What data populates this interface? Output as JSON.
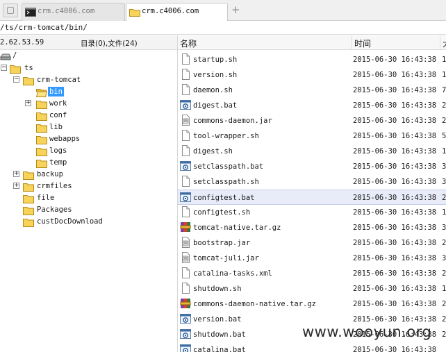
{
  "tabs": [
    {
      "label": "crm.c4006.com",
      "icon": "terminal-icon",
      "active": false
    },
    {
      "label": "crm.c4006.com",
      "icon": "folder-icon",
      "active": true
    }
  ],
  "path": "/ts/crm-tomcat/bin/",
  "left_panel": {
    "host": "2.62.53.59",
    "summary": "目录(0),文件(24)"
  },
  "tree": [
    {
      "label": "/",
      "icon": "drive-icon",
      "expander": ""
    },
    {
      "label": "ts",
      "icon": "folder-icon",
      "expander": "−"
    },
    {
      "label": "crm-tomcat",
      "icon": "folder-icon",
      "expander": "−"
    },
    {
      "label": "bin",
      "icon": "folder-open-icon",
      "expander": "",
      "selected": true
    },
    {
      "label": "work",
      "icon": "folder-icon",
      "expander": "+"
    },
    {
      "label": "conf",
      "icon": "folder-icon",
      "expander": ""
    },
    {
      "label": "lib",
      "icon": "folder-icon",
      "expander": ""
    },
    {
      "label": "webapps",
      "icon": "folder-icon",
      "expander": ""
    },
    {
      "label": "logs",
      "icon": "folder-icon",
      "expander": ""
    },
    {
      "label": "temp",
      "icon": "folder-icon",
      "expander": ""
    },
    {
      "label": "backup",
      "icon": "folder-icon",
      "expander": "+"
    },
    {
      "label": "crmfiles",
      "icon": "folder-icon",
      "expander": "+"
    },
    {
      "label": "file",
      "icon": "folder-icon",
      "expander": ""
    },
    {
      "label": "Packages",
      "icon": "folder-icon",
      "expander": ""
    },
    {
      "label": "custDocDownload",
      "icon": "folder-icon",
      "expander": ""
    }
  ],
  "columns": {
    "name": "名称",
    "time": "时间",
    "size": "大"
  },
  "files": [
    {
      "name": "startup.sh",
      "time": "2015-06-30 16:43:38",
      "size": "1",
      "icon": "document-icon"
    },
    {
      "name": "version.sh",
      "time": "2015-06-30 16:43:38",
      "size": "1",
      "icon": "document-icon"
    },
    {
      "name": "daemon.sh",
      "time": "2015-06-30 16:43:38",
      "size": "7",
      "icon": "document-icon"
    },
    {
      "name": "digest.bat",
      "time": "2015-06-30 16:43:38",
      "size": "2",
      "icon": "batch-file-icon"
    },
    {
      "name": "commons-daemon.jar",
      "time": "2015-06-30 16:43:38",
      "size": "2",
      "icon": "jar-file-icon"
    },
    {
      "name": "tool-wrapper.sh",
      "time": "2015-06-30 16:43:38",
      "size": "5",
      "icon": "document-icon"
    },
    {
      "name": "digest.sh",
      "time": "2015-06-30 16:43:38",
      "size": "1",
      "icon": "document-icon"
    },
    {
      "name": "setclasspath.bat",
      "time": "2015-06-30 16:43:38",
      "size": "3",
      "icon": "batch-file-icon"
    },
    {
      "name": "setclasspath.sh",
      "time": "2015-06-30 16:43:38",
      "size": "3",
      "icon": "document-icon"
    },
    {
      "name": "configtest.bat",
      "time": "2015-06-30 16:43:38",
      "size": "2",
      "icon": "batch-file-icon",
      "selected": true
    },
    {
      "name": "configtest.sh",
      "time": "2015-06-30 16:43:38",
      "size": "1",
      "icon": "document-icon"
    },
    {
      "name": "tomcat-native.tar.gz",
      "time": "2015-06-30 16:43:38",
      "size": "3",
      "icon": "archive-icon"
    },
    {
      "name": "bootstrap.jar",
      "time": "2015-06-30 16:43:38",
      "size": "2",
      "icon": "jar-file-icon"
    },
    {
      "name": "tomcat-juli.jar",
      "time": "2015-06-30 16:43:38",
      "size": "3",
      "icon": "jar-file-icon"
    },
    {
      "name": "catalina-tasks.xml",
      "time": "2015-06-30 16:43:38",
      "size": "2",
      "icon": "document-icon"
    },
    {
      "name": "shutdown.sh",
      "time": "2015-06-30 16:43:38",
      "size": "1",
      "icon": "document-icon"
    },
    {
      "name": "commons-daemon-native.tar.gz",
      "time": "2015-06-30 16:43:38",
      "size": "2",
      "icon": "archive-icon"
    },
    {
      "name": "version.bat",
      "time": "2015-06-30 16:43:38",
      "size": "2",
      "icon": "batch-file-icon"
    },
    {
      "name": "shutdown.bat",
      "time": "2015-06-30 16:43:38",
      "size": "2",
      "icon": "batch-file-icon"
    },
    {
      "name": "catalina.bat",
      "time": "2015-06-30 16:43:38",
      "size": "",
      "icon": "batch-file-icon"
    }
  ],
  "watermark": "www.wooyun.org",
  "colors": {
    "selection": "#3399ff",
    "folder": "#f7d35a",
    "row_highlight": "#e8ebf8"
  }
}
